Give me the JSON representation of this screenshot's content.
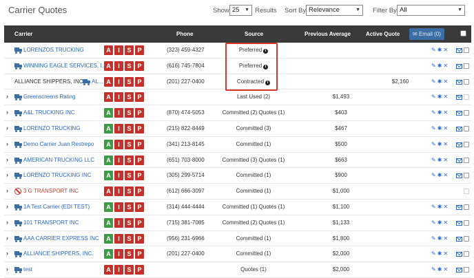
{
  "page": {
    "title": "Carrier Quotes"
  },
  "controls": {
    "show_label": "Show",
    "show_value": "25",
    "results_label": "Results",
    "sort_label": "Sort By",
    "sort_value": "Relevance",
    "filter_label": "Filter By",
    "filter_value": "All"
  },
  "table": {
    "headers": {
      "carrier": "Carrier",
      "phone": "Phone",
      "source": "Source",
      "avg": "Previous Average",
      "active": "Active Quote",
      "email": "Email (0)"
    },
    "badges": [
      "A",
      "I",
      "S",
      "P"
    ],
    "actions": {
      "edit": "✎",
      "pin": "✱",
      "remove": "✕"
    },
    "rows": [
      {
        "carrier": "LORENZOS TRUCKING",
        "phone": "(323) 459-4327",
        "source": "Preferred",
        "avg": "",
        "active": "",
        "chevron": false,
        "icon": "truck",
        "info": true,
        "greenA": false,
        "disabled": false
      },
      {
        "carrier": "WINNING EAGLE SERVICES, I...",
        "phone": "(616) 745-7804",
        "source": "Preferred",
        "avg": "",
        "active": "",
        "chevron": false,
        "icon": "truck",
        "info": true,
        "greenA": false,
        "disabled": false
      },
      {
        "carrier_prefix": "ALLIANCE SHIPPERS, INC.",
        "carrier": "AL...",
        "phone": "(201) 227-0400",
        "source": "Contracted",
        "avg": "",
        "active": "$2,160",
        "chevron": false,
        "icon": "truck",
        "info": true,
        "greenA": false,
        "disabled": false
      },
      {
        "carrier": "Greenscreens Rating",
        "phone": "",
        "source": "Last Used (2)",
        "avg": "$1,493",
        "active": "",
        "chevron": true,
        "icon": "truck",
        "info": false,
        "greenA": false,
        "disabled": true
      },
      {
        "carrier": "A&L TRUCKING INC",
        "phone": "(870) 474-5053",
        "source": "Committed (2) Quotes (1)",
        "avg": "$403",
        "active": "",
        "chevron": true,
        "icon": "truck",
        "info": false,
        "greenA": true,
        "disabled": false
      },
      {
        "carrier": "LORENZO TRUCKING",
        "phone": "(215) 822-8449",
        "source": "Committed (3)",
        "avg": "$467",
        "active": "",
        "chevron": true,
        "icon": "truck",
        "info": false,
        "greenA": true,
        "disabled": false
      },
      {
        "carrier": "Demo Carrier Juan Restrepo",
        "phone": "(341) 213-8145",
        "source": "Committed (1)",
        "avg": "$500",
        "active": "",
        "chevron": true,
        "icon": "truck",
        "info": false,
        "greenA": true,
        "disabled": false
      },
      {
        "carrier": "AMERICAN TRUCKING LLC",
        "phone": "(651) 703-8000",
        "source": "Committed (3) Quotes (1)",
        "avg": "$663",
        "active": "",
        "chevron": true,
        "icon": "truck",
        "info": false,
        "greenA": true,
        "disabled": false
      },
      {
        "carrier": "LORENZO TRUCKING INC",
        "phone": "(305) 299-5714",
        "source": "Committed (1)",
        "avg": "$900",
        "active": "",
        "chevron": true,
        "icon": "truck",
        "info": false,
        "greenA": true,
        "disabled": false
      },
      {
        "carrier": "3 G TRANSPORT INC",
        "phone": "(612) 666-3097",
        "source": "Committed (1)",
        "avg": "$1,000",
        "active": "",
        "chevron": true,
        "icon": "ban",
        "info": false,
        "greenA": false,
        "disabled": true
      },
      {
        "carrier": "1A Test Carrier (EDI TEST)",
        "phone": "(314) 444-4444",
        "source": "Committed (1) Quotes (1)",
        "avg": "$1,100",
        "active": "",
        "chevron": true,
        "icon": "truck",
        "info": false,
        "greenA": true,
        "disabled": false
      },
      {
        "carrier": "101 TRANSPORT INC",
        "phone": "(715) 381-7085",
        "source": "Committed (2) Quotes (1)",
        "avg": "$1,133",
        "active": "",
        "chevron": true,
        "icon": "truck",
        "info": false,
        "greenA": true,
        "disabled": false
      },
      {
        "carrier": "AAA CARRIER EXPRESS INC",
        "phone": "(956) 231-6966",
        "source": "Committed (1)",
        "avg": "$1,800",
        "active": "",
        "chevron": true,
        "icon": "truck",
        "info": false,
        "greenA": true,
        "disabled": false
      },
      {
        "carrier": "ALLIANCE SHIPPERS, INC.",
        "phone": "(201) 227-0400",
        "source": "Committed (1)",
        "avg": "$2,000",
        "active": "",
        "chevron": true,
        "icon": "truck",
        "info": false,
        "greenA": true,
        "disabled": false
      },
      {
        "carrier": "test",
        "phone": "",
        "source": "Quotes (1)",
        "avg": "$2,000",
        "active": "",
        "chevron": true,
        "icon": "truck",
        "info": false,
        "greenA": false,
        "disabled": false
      }
    ]
  },
  "colors": {
    "link": "#2a66c9",
    "danger": "#c6302b",
    "success": "#3d9b45",
    "header": "#3a3a3a",
    "highlight": "#d9362b"
  }
}
